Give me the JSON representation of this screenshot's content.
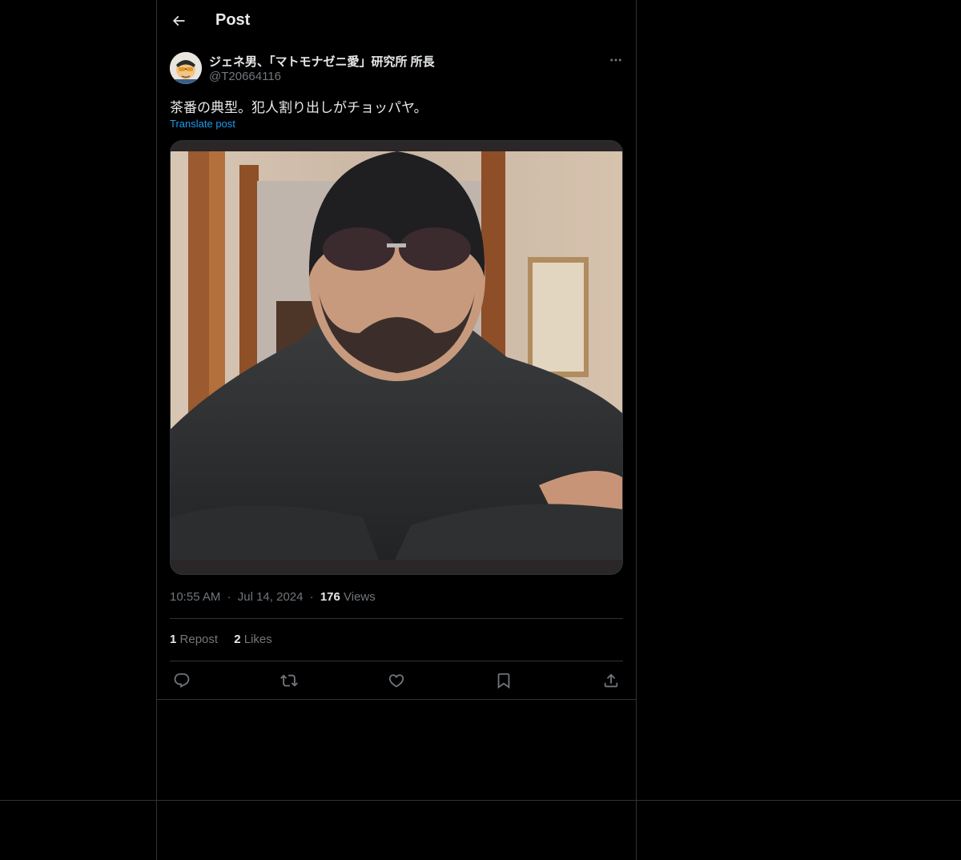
{
  "header": {
    "title": "Post",
    "back_icon": "arrow-left-icon"
  },
  "post": {
    "author": {
      "display_name": "ジェネ男、「マトモナゼニ愛」研究所 所長",
      "handle": "@T20664116",
      "avatar_icon": "avatar-cartoon"
    },
    "text": "茶番の典型。犯人割り出しがチョッパヤ。",
    "translate_label": "Translate post",
    "media": {
      "kind": "video-frame",
      "icon": "media-image"
    },
    "time": "10:55 AM",
    "date": "Jul 14, 2024",
    "views_count": "176",
    "views_label": "Views",
    "reposts_count": "1",
    "reposts_label": "Repost",
    "likes_count": "2",
    "likes_label": "Likes",
    "dot": "·"
  },
  "actions": {
    "reply_icon": "reply-icon",
    "repost_icon": "repost-icon",
    "like_icon": "heart-icon",
    "bookmark_icon": "bookmark-icon",
    "share_icon": "share-icon"
  },
  "colors": {
    "background": "#000000",
    "text": "#e7e9ea",
    "muted": "#71767b",
    "link": "#1d9bf0",
    "border": "#2f3336"
  }
}
